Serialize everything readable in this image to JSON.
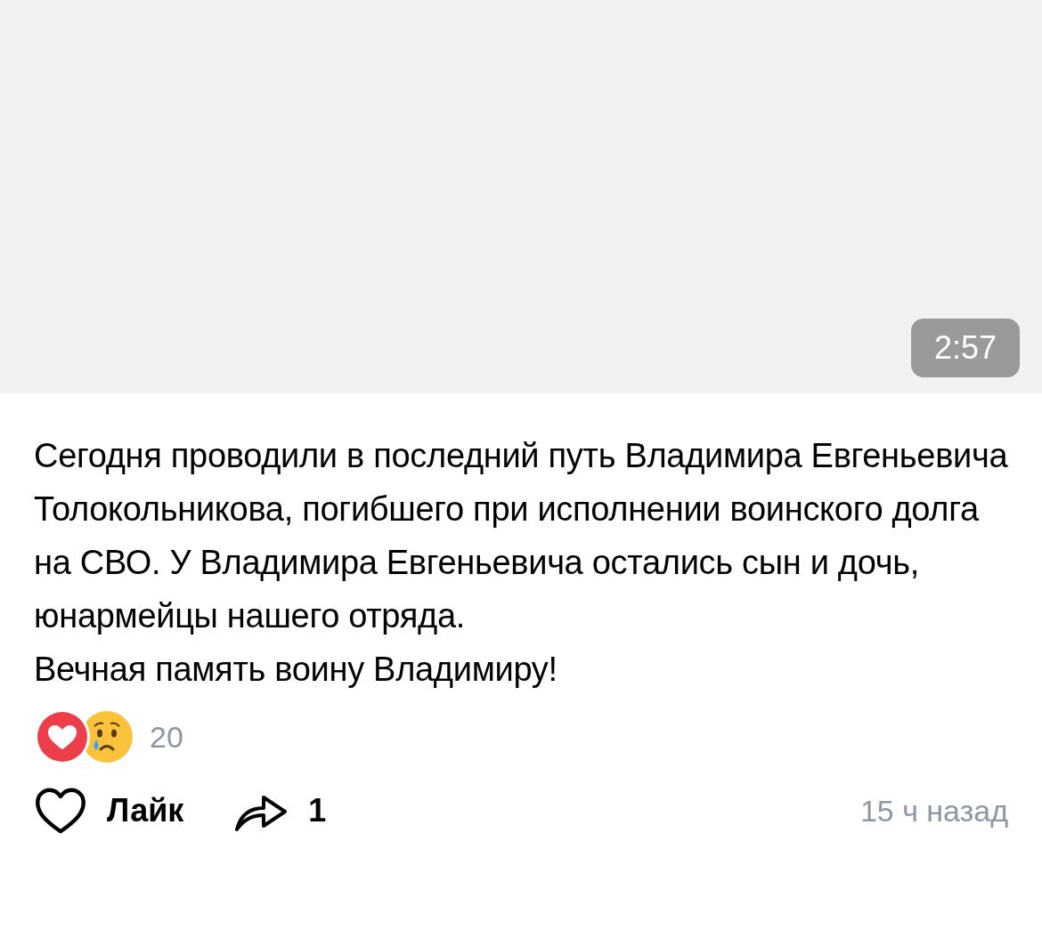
{
  "video": {
    "duration": "2:57"
  },
  "post_text": [
    "Сегодня проводили в последний путь Владимира Евгеньевича Толокольникова, погибшего при исполнении воинского долга на СВО. У Владимира Евгеньевича остались сын и дочь, юнармейцы нашего отряда.",
    "Вечная память воину Владимиру!"
  ],
  "reactions": {
    "items": [
      {
        "kind": "heart"
      },
      {
        "kind": "crying"
      }
    ],
    "count": "20"
  },
  "actions": {
    "like": {
      "label": "Лайк",
      "liked": false
    },
    "share": {
      "count": "1"
    },
    "time": "15 ч назад"
  }
}
